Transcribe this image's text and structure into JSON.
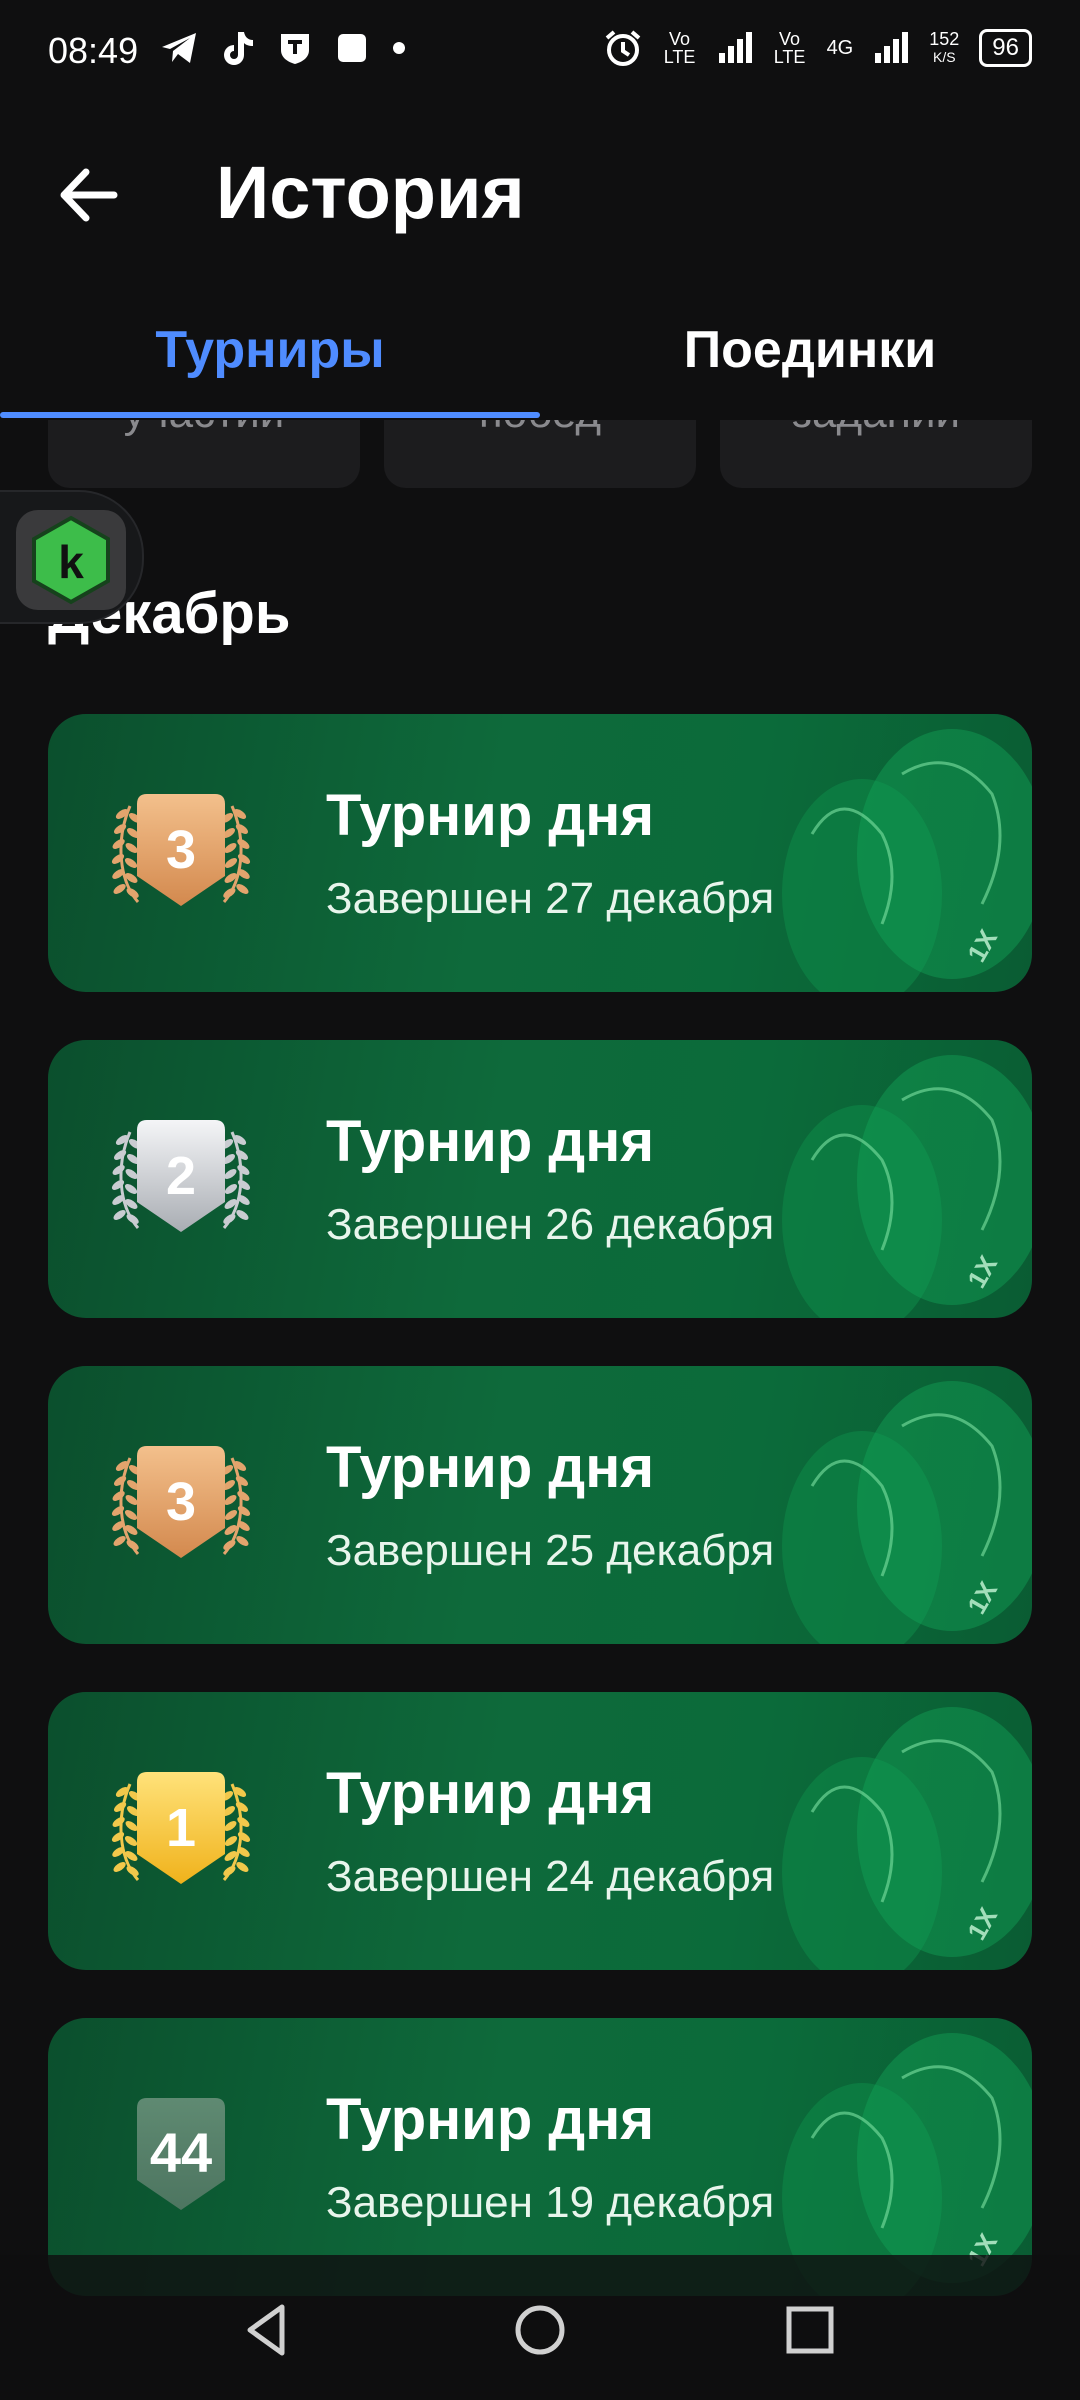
{
  "status_bar": {
    "time": "08:49",
    "left_icons": [
      "telegram-icon",
      "tiktok-icon",
      "shield-app-icon",
      "square-app-icon",
      "dot-icon"
    ],
    "alarm": "alarm-icon",
    "volte1": "Vo LTE",
    "volte2": "Vo LTE",
    "network": "4G",
    "speed_value": "152",
    "speed_unit": "K/S",
    "battery": "96"
  },
  "header": {
    "title": "История"
  },
  "tabs": [
    {
      "label": "Турниры",
      "active": true
    },
    {
      "label": "Поединки",
      "active": false
    }
  ],
  "stats": [
    {
      "label": "участий"
    },
    {
      "label": "побед"
    },
    {
      "label": "заданий"
    }
  ],
  "section": {
    "title": "Декабрь"
  },
  "tournaments": [
    {
      "title": "Турнир дня",
      "subtitle": "Завершен 27 декабря",
      "place": "3",
      "medal": "bronze"
    },
    {
      "title": "Турнир дня",
      "subtitle": "Завершен 26 декабря",
      "place": "2",
      "medal": "silver"
    },
    {
      "title": "Турнир дня",
      "subtitle": "Завершен 25 декабря",
      "place": "3",
      "medal": "bronze"
    },
    {
      "title": "Турнир дня",
      "subtitle": "Завершен 24 декабря",
      "place": "1",
      "medal": "gold"
    },
    {
      "title": "Турнир дня",
      "subtitle": "Завершен 19 декабря",
      "place": "44",
      "medal": "none"
    }
  ],
  "colors": {
    "accent": "#4f8cff",
    "background": "#0f0f10",
    "card_green": "#0e6a3b",
    "gold": "#f6c427",
    "silver": "#c9ccd1",
    "bronze": "#e3a46d"
  },
  "nav": [
    "back-triangle-icon",
    "home-circle-icon",
    "recents-square-icon"
  ]
}
